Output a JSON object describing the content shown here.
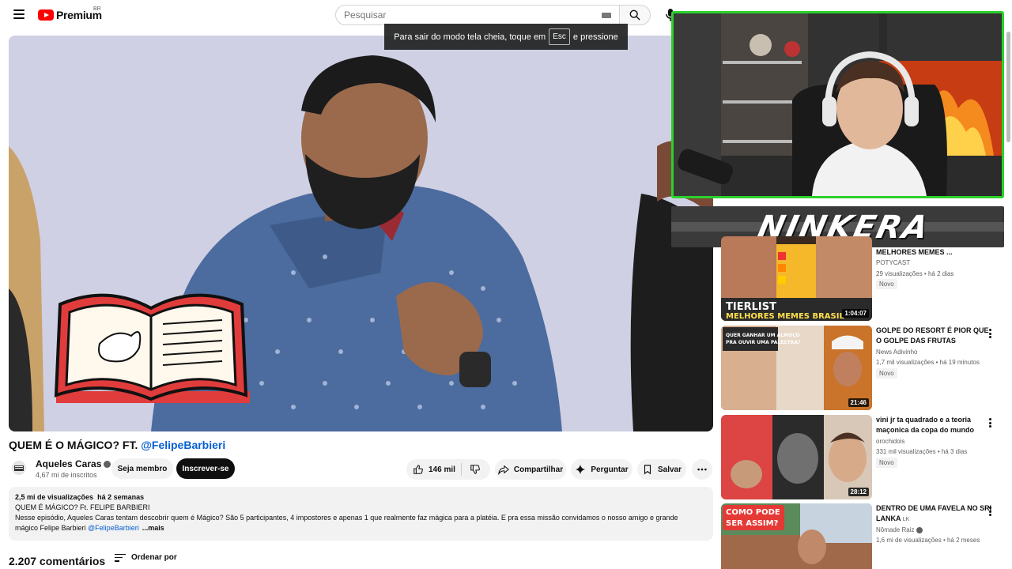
{
  "header": {
    "logo_text": "Premium",
    "country": "BR",
    "search_placeholder": "Pesquisar"
  },
  "toast": {
    "before": "Para sair do modo tela cheia, toque em",
    "key": "Esc",
    "after": "e pressione"
  },
  "overlay": {
    "banner_text": "NINKERA"
  },
  "video": {
    "title_prefix": "QUEM É O MÁGICO? FT. ",
    "title_mention": "@FelipeBarbieri",
    "channel_name": "Aqueles Caras",
    "subscribers": "4,67 mi de inscritos",
    "member_label": "Seja membro",
    "subscribe_label": "Inscrever-se",
    "likes": "146 mil",
    "share_label": "Compartilhar",
    "ask_label": "Perguntar",
    "save_label": "Salvar"
  },
  "description": {
    "views": "2,5 mi de visualizações",
    "age": "há 2 semanas",
    "line1": "QUEM É MÁGICO? Ft. FELIPE BARBIERI",
    "line2": "Nesse episódio, Aqueles Caras tentam descobrir quem é Mágico? São 5 participantes, 4 impostores e apenas 1 que realmente faz mágica para a platéia. E pra essa missão convidamos o nosso amigo e grande",
    "line3_prefix": "mágico Felipe Barbieri ",
    "line3_mention": "@FelipeBarbieri",
    "more": "...mais"
  },
  "comments": {
    "count_label": "2.207 comentários",
    "sort_label": "Ordenar por"
  },
  "recommendations": [
    {
      "title": "MELHORES MEMES ...",
      "channel": "POTYCAST",
      "views": "29 visualizações",
      "age": "há 2 dias",
      "badge": "Novo",
      "duration": "1:04:07",
      "thumb_text": "TIERLIST MELHORES MEMES BRASIL"
    },
    {
      "title": "GOLPE DO RESORT É PIOR QUE O GOLPE DAS FRUTAS",
      "channel": "News Adivinho",
      "views": "1,7 mil visualizações",
      "age": "há 19 minutos",
      "badge": "Novo",
      "duration": "21:46",
      "thumb_text": "QUER GANHAR UM ALMOÇO PRA OUVIR UMA PALESTRA?"
    },
    {
      "title": "vini jr ta quadrado e a teoria maçonica da copa do mundo",
      "channel": "orochidois",
      "views": "331 mil visualizações",
      "age": "há 3 dias",
      "badge": "Novo",
      "duration": "28:12",
      "thumb_text": ""
    },
    {
      "title": "DENTRO DE UMA FAVELA NO SRI LANKA",
      "title_suffix": "LK",
      "channel": "Nômade Raiz",
      "views": "1,6 mi de visualizações",
      "age": "há 2 meses",
      "badge": "",
      "duration": "",
      "thumb_text": "COMO PODE SER ASSIM?"
    }
  ]
}
